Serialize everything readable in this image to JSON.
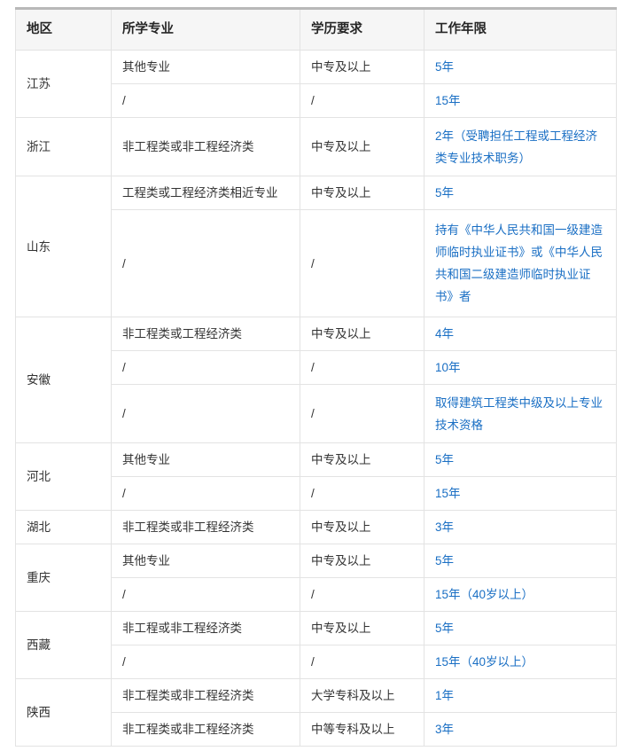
{
  "table": {
    "columns": [
      "地区",
      "所学专业",
      "学历要求",
      "工作年限"
    ],
    "accent_text_color": "#1a6fc4",
    "header_bg": "#f6f6f6",
    "border_color": "#e3e3e3",
    "groups": [
      {
        "region": "江苏",
        "rows": [
          {
            "major": "其他专业",
            "education": "中专及以上",
            "years": "5年",
            "height": "h1"
          },
          {
            "major": "/",
            "education": "/",
            "years": "15年",
            "height": "h1"
          }
        ]
      },
      {
        "region": "浙江",
        "rows": [
          {
            "major": "非工程类或非工程经济类",
            "education": "中专及以上",
            "years": "2年（受聘担任工程或工程经济类专业技术职务）",
            "height": "h2"
          }
        ]
      },
      {
        "region": "山东",
        "rows": [
          {
            "major": "工程类或工程经济类相近专业",
            "education": "中专及以上",
            "years": "5年",
            "height": "h1"
          },
          {
            "major": "/",
            "education": "/",
            "years": "持有《中华人民共和国一级建造师临时执业证书》或《中华人民共和国二级建造师临时执业证书》者",
            "height": "h4"
          }
        ]
      },
      {
        "region": "安徽",
        "rows": [
          {
            "major": "非工程类或工程经济类",
            "education": "中专及以上",
            "years": "4年",
            "height": "h1"
          },
          {
            "major": "/",
            "education": "/",
            "years": "10年",
            "height": "h1"
          },
          {
            "major": "/",
            "education": "/",
            "years": "取得建筑工程类中级及以上专业技术资格",
            "height": "h2"
          }
        ]
      },
      {
        "region": "河北",
        "rows": [
          {
            "major": "其他专业",
            "education": "中专及以上",
            "years": "5年",
            "height": "h1"
          },
          {
            "major": "/",
            "education": "/",
            "years": "15年",
            "height": "h1"
          }
        ]
      },
      {
        "region": "湖北",
        "rows": [
          {
            "major": "非工程类或非工程经济类",
            "education": "中专及以上",
            "years": "3年",
            "height": "h1"
          }
        ]
      },
      {
        "region": "重庆",
        "rows": [
          {
            "major": "其他专业",
            "education": "中专及以上",
            "years": "5年",
            "height": "h1"
          },
          {
            "major": "/",
            "education": "/",
            "years": "15年（40岁以上）",
            "height": "h1"
          }
        ]
      },
      {
        "region": "西藏",
        "rows": [
          {
            "major": "非工程或非工程经济类",
            "education": "中专及以上",
            "years": "5年",
            "height": "h1"
          },
          {
            "major": "/",
            "education": "/",
            "years": "15年（40岁以上）",
            "height": "h1"
          }
        ]
      },
      {
        "region": "陕西",
        "rows": [
          {
            "major": "非工程类或非工程经济类",
            "education": "大学专科及以上",
            "years": "1年",
            "height": "h1"
          },
          {
            "major": "非工程类或非工程经济类",
            "education": "中等专科及以上",
            "years": "3年",
            "height": "h1"
          }
        ]
      }
    ]
  }
}
